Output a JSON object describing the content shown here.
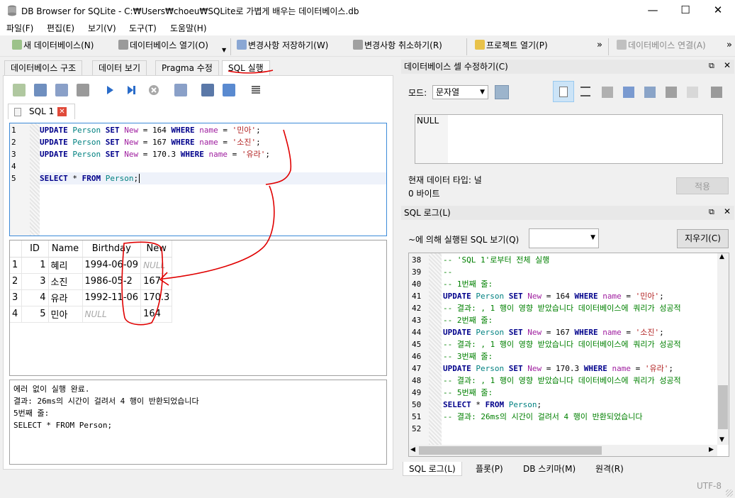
{
  "window": {
    "title": "DB Browser for SQLite - C:₩Users₩choeu₩SQLite로 가볍게 배우는 데이터베이스.db",
    "minimize": "—",
    "maximize": "☐",
    "close": "✕"
  },
  "menu": [
    "파일(F)",
    "편집(E)",
    "보기(V)",
    "도구(T)",
    "도움말(H)"
  ],
  "toolbar": {
    "new_db": "새 데이터베이스(N)",
    "open_db": "데이터베이스 열기(O)",
    "write_changes": "변경사항 저장하기(W)",
    "revert_changes": "변경사항 취소하기(R)",
    "open_project": "프로젝트 열기(P)",
    "attach_db": "데이터베이스 연결(A)",
    "overflow": "»"
  },
  "tabs": [
    "데이터베이스 구조",
    "데이터 보기",
    "Pragma 수정",
    "SQL 실행"
  ],
  "sql_tab": {
    "label": "SQL 1",
    "lines": [
      {
        "n": "1",
        "kw1": "UPDATE",
        "tbl": "Person",
        "kw2": "SET",
        "col1": "New",
        "eq1": " = ",
        "num": "164",
        "kw3": "WHERE",
        "col2": "name",
        "eq2": " = ",
        "str": "'민아'",
        "end": ";"
      },
      {
        "n": "2",
        "kw1": "UPDATE",
        "tbl": "Person",
        "kw2": "SET",
        "col1": "New",
        "eq1": " = ",
        "num": "167",
        "kw3": "WHERE",
        "col2": "name",
        "eq2": " = ",
        "str": "'소진'",
        "end": ";"
      },
      {
        "n": "3",
        "kw1": "UPDATE",
        "tbl": "Person",
        "kw2": "SET",
        "col1": "New",
        "eq1": " = ",
        "num": "170.3",
        "kw3": "WHERE",
        "col2": "name",
        "eq2": " = ",
        "str": "'유라'",
        "end": ";"
      }
    ],
    "line4": "4",
    "line5": {
      "n": "5",
      "kw1": "SELECT",
      "star": " * ",
      "kw2": "FROM",
      "tbl": "Person",
      "end": ";"
    }
  },
  "results": {
    "headers": [
      "ID",
      "Name",
      "Birthday",
      "New"
    ],
    "rows": [
      {
        "rn": "1",
        "id": "1",
        "name": "혜리",
        "birthday": "1994-06-09",
        "new": "NULL"
      },
      {
        "rn": "2",
        "id": "3",
        "name": "소진",
        "birthday": "1986-05-2",
        "new": "167"
      },
      {
        "rn": "3",
        "id": "4",
        "name": "유라",
        "birthday": "1992-11-06",
        "new": "170.3"
      },
      {
        "rn": "4",
        "id": "5",
        "name": "민아",
        "birthday": "NULL",
        "new": "164"
      }
    ]
  },
  "message": {
    "line1": "에러 없이 실행 완료.",
    "line2": "결과: 26ms의 시간이 걸려서 4 행이 반환되었습니다",
    "line3": "5번째 줄:",
    "line4": "SELECT * FROM Person;"
  },
  "cell_editor": {
    "title": "데이터베이스 셀 수정하기(C)",
    "mode_label": "모드:",
    "mode_value": "문자열",
    "value": "NULL",
    "type_label": "현재 데이터 타입: 널",
    "size_label": "0 바이트",
    "apply": "적용"
  },
  "sql_log": {
    "title": "SQL 로그(L)",
    "filter_label": "~에 의해 실행된 SQL 보기(Q)",
    "clear": "지우기(C)",
    "lines": [
      {
        "n": "38",
        "t": "-- 'SQL 1'로부터 전체 실행"
      },
      {
        "n": "39",
        "t": "--"
      },
      {
        "n": "40",
        "t": "-- 1번째 줄:"
      },
      {
        "n": "41",
        "t": "UPDATE Person SET New = 164 WHERE name = '민아';"
      },
      {
        "n": "42",
        "t": "-- 결과: , 1 행이 영향 받았습니다 데이터베이스에 쿼리가 성공적"
      },
      {
        "n": "43",
        "t": "-- 2번째 줄:"
      },
      {
        "n": "44",
        "t": "UPDATE Person SET New = 167 WHERE name = '소진';"
      },
      {
        "n": "45",
        "t": "-- 결과: , 1 행이 영향 받았습니다 데이터베이스에 쿼리가 성공적"
      },
      {
        "n": "46",
        "t": "-- 3번째 줄:"
      },
      {
        "n": "47",
        "t": "UPDATE Person SET New = 170.3 WHERE name = '유라';"
      },
      {
        "n": "48",
        "t": "-- 결과: , 1 행이 영향 받았습니다 데이터베이스에 쿼리가 성공적"
      },
      {
        "n": "49",
        "t": "-- 5번째 줄:"
      },
      {
        "n": "50",
        "t": "SELECT * FROM Person;"
      },
      {
        "n": "51",
        "t": "-- 결과: 26ms의 시간이 걸려서 4 행이 반환되었습니다"
      },
      {
        "n": "52",
        "t": ""
      }
    ]
  },
  "bottom_tabs": [
    "SQL 로그(L)",
    "플롯(P)",
    "DB 스키마(M)",
    "원격(R)"
  ],
  "status": {
    "encoding": "UTF-8"
  },
  "colors": {
    "annotation": "#e00000",
    "accent": "#cce4f7"
  }
}
